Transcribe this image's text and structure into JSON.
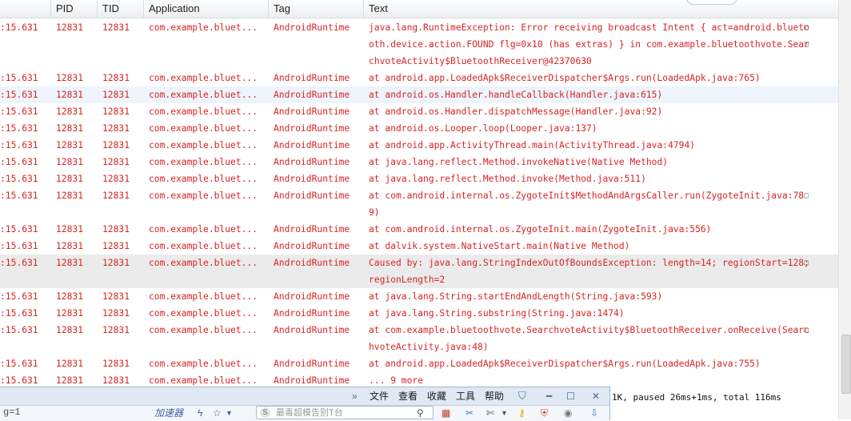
{
  "columns": {
    "pid": "PID",
    "tid": "TID",
    "app": "Application",
    "tag": "Tag",
    "text": "Text"
  },
  "rows": [
    {
      "time": ":15.631",
      "pid": "12831",
      "tid": "12831",
      "app": "com.example.bluet...",
      "tag": "AndroidRuntime",
      "text": "java.lang.RuntimeException: Error receiving broadcast Intent { act=android.bluetooth.device.action.FOUND flg=0x10 (has extras) } in com.example.bluetoothvote.SearchvoteActivity$BluetoothReceiver@42370630",
      "lines": 3
    },
    {
      "time": ":15.631",
      "pid": "12831",
      "tid": "12831",
      "app": "com.example.bluet...",
      "tag": "AndroidRuntime",
      "text": "at android.app.LoadedApk$ReceiverDispatcher$Args.run(LoadedApk.java:765)",
      "lines": 1
    },
    {
      "time": ":15.631",
      "pid": "12831",
      "tid": "12831",
      "app": "com.example.bluet...",
      "tag": "AndroidRuntime",
      "text": "at android.os.Handler.handleCallback(Handler.java:615)",
      "lines": 1,
      "state": "selected"
    },
    {
      "time": ":15.631",
      "pid": "12831",
      "tid": "12831",
      "app": "com.example.bluet...",
      "tag": "AndroidRuntime",
      "text": "at android.os.Handler.dispatchMessage(Handler.java:92)",
      "lines": 1
    },
    {
      "time": ":15.631",
      "pid": "12831",
      "tid": "12831",
      "app": "com.example.bluet...",
      "tag": "AndroidRuntime",
      "text": "at android.os.Looper.loop(Looper.java:137)",
      "lines": 1
    },
    {
      "time": ":15.631",
      "pid": "12831",
      "tid": "12831",
      "app": "com.example.bluet...",
      "tag": "AndroidRuntime",
      "text": "at android.app.ActivityThread.main(ActivityThread.java:4794)",
      "lines": 1
    },
    {
      "time": ":15.631",
      "pid": "12831",
      "tid": "12831",
      "app": "com.example.bluet...",
      "tag": "AndroidRuntime",
      "text": "at java.lang.reflect.Method.invokeNative(Native Method)",
      "lines": 1
    },
    {
      "time": ":15.631",
      "pid": "12831",
      "tid": "12831",
      "app": "com.example.bluet...",
      "tag": "AndroidRuntime",
      "text": "at java.lang.reflect.Method.invoke(Method.java:511)",
      "lines": 1
    },
    {
      "time": ":15.631",
      "pid": "12831",
      "tid": "12831",
      "app": "com.example.bluet...",
      "tag": "AndroidRuntime",
      "text": "at com.android.internal.os.ZygoteInit$MethodAndArgsCaller.run(ZygoteInit.java:789)",
      "lines": 2
    },
    {
      "time": ":15.631",
      "pid": "12831",
      "tid": "12831",
      "app": "com.example.bluet...",
      "tag": "AndroidRuntime",
      "text": "at com.android.internal.os.ZygoteInit.main(ZygoteInit.java:556)",
      "lines": 1
    },
    {
      "time": ":15.631",
      "pid": "12831",
      "tid": "12831",
      "app": "com.example.bluet...",
      "tag": "AndroidRuntime",
      "text": "at dalvik.system.NativeStart.main(Native Method)",
      "lines": 1
    },
    {
      "time": ":15.631",
      "pid": "12831",
      "tid": "12831",
      "app": "com.example.bluet...",
      "tag": "AndroidRuntime",
      "text": "Caused by: java.lang.StringIndexOutOfBoundsException: length=14; regionStart=128; regionLength=2",
      "lines": 2,
      "state": "hover"
    },
    {
      "time": ":15.631",
      "pid": "12831",
      "tid": "12831",
      "app": "com.example.bluet...",
      "tag": "AndroidRuntime",
      "text": "at java.lang.String.startEndAndLength(String.java:593)",
      "lines": 1
    },
    {
      "time": ":15.631",
      "pid": "12831",
      "tid": "12831",
      "app": "com.example.bluet...",
      "tag": "AndroidRuntime",
      "text": "at java.lang.String.substring(String.java:1474)",
      "lines": 1
    },
    {
      "time": ":15.631",
      "pid": "12831",
      "tid": "12831",
      "app": "com.example.bluet...",
      "tag": "AndroidRuntime",
      "text": "at com.example.bluetoothvote.SearchvoteActivity$BluetoothReceiver.onReceive(SearchvoteActivity.java:48)",
      "lines": 2
    },
    {
      "time": ":15.631",
      "pid": "12831",
      "tid": "12831",
      "app": "com.example.bluet...",
      "tag": "AndroidRuntime",
      "text": "at android.app.LoadedApk$ReceiverDispatcher$Args.run(LoadedApk.java:755)",
      "lines": 1
    },
    {
      "time": ":15.631",
      "pid": "12831",
      "tid": "12831",
      "app": "com.example.bluet...",
      "tag": "AndroidRuntime",
      "text": "... 9 more",
      "lines": 1
    }
  ],
  "status_text": "1K, paused 26ms+1ms, total 116ms",
  "toolbar": {
    "chevrons": "»",
    "menu": [
      "文件",
      "查看",
      "收藏",
      "工具",
      "帮助"
    ],
    "filter_text": "g=1",
    "accelerator_label": "加速器",
    "search_placeholder": "最毒超模告别T台",
    "search_brand": "S"
  },
  "colors": {
    "log_error": "#d62424",
    "selected_row": "#eef4fb",
    "hover_row": "#ebebeb",
    "toolbar_bg": "#dfe8f3"
  }
}
